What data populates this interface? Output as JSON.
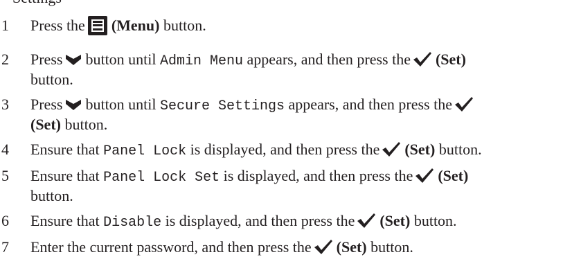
{
  "top_fragment": "Settings",
  "steps": [
    {
      "num": "1",
      "pre": "Press the",
      "bold": "(Menu)",
      "post": "button."
    },
    {
      "num": "2",
      "pre": "Press",
      "mid": "button until",
      "code": "Admin Menu",
      "post": "appears, and then press the",
      "bold": "(Set)",
      "tail": "button."
    },
    {
      "num": "3",
      "pre": "Press",
      "mid": "button until",
      "code": "Secure Settings",
      "post": "appears, and then press the",
      "bold": "(Set)",
      "tail": "button."
    },
    {
      "num": "4",
      "pre": "Ensure that",
      "code": "Panel Lock",
      "post": "is displayed, and then press the",
      "bold": "(Set)",
      "tail": "button."
    },
    {
      "num": "5",
      "pre": "Ensure that",
      "code": "Panel Lock Set",
      "post": "is displayed, and then press the",
      "bold": "(Set)",
      "tail": "button."
    },
    {
      "num": "6",
      "pre": "Ensure that",
      "code": "Disable",
      "post": "is displayed, and then press the",
      "bold": "(Set)",
      "tail": "button."
    },
    {
      "num": "7",
      "pre": "Enter the current password, and then press the",
      "bold": "(Set)",
      "tail": "button."
    }
  ],
  "icons": {
    "menu": "menu-button-icon",
    "down": "down-arrow-icon",
    "set": "checkmark-icon"
  }
}
